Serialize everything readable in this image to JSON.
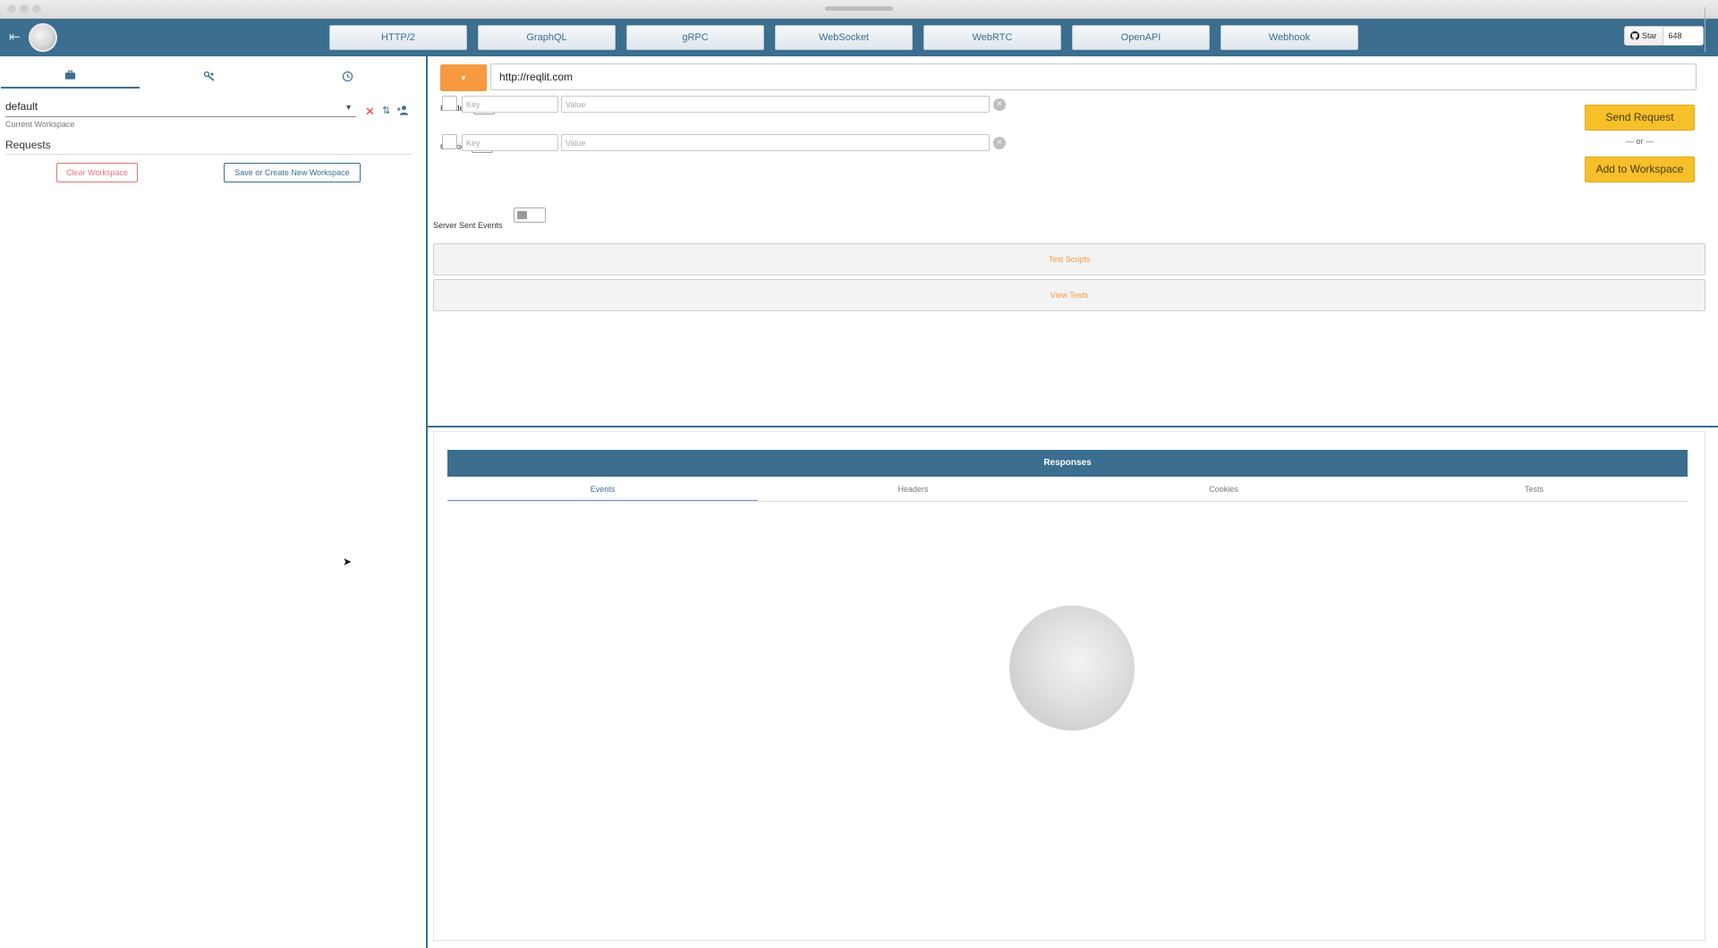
{
  "header": {
    "nav_tabs": [
      "HTTP/2",
      "GraphQL",
      "gRPC",
      "WebSocket",
      "WebRTC",
      "OpenAPI",
      "Webhook"
    ],
    "github": {
      "star_label": "Star",
      "count": "648"
    },
    "brand_color": "#3b6e8f"
  },
  "sidebar": {
    "tabs": [
      {
        "icon": "briefcase-icon"
      },
      {
        "icon": "tools-icon"
      },
      {
        "icon": "clock-icon"
      }
    ],
    "workspace_select": {
      "value": "default",
      "helper": "Current Workspace"
    },
    "requests_title": "Requests",
    "clear_workspace_label": "Clear Workspace",
    "save_workspace_label": "Save or Create New Workspace"
  },
  "request": {
    "method_label": "",
    "method_color": "#f6993f",
    "url": "http://reqlit.com",
    "headers_label": "Headers",
    "cookies_label": "Cookies",
    "key_placeholder": "Key",
    "value_placeholder": "Value",
    "send_label": "Send Request",
    "or_label": "— or —",
    "add_label": "Add to Workspace",
    "sse_label": "Server Sent Events",
    "test_scripts_label": "Test Scripts",
    "view_tests_label": "View Tests",
    "accent_color": "#f6c02b"
  },
  "responses": {
    "title": "Responses",
    "tabs": [
      "Events",
      "Headers",
      "Cookies",
      "Tests"
    ],
    "active_tab": "Events"
  }
}
